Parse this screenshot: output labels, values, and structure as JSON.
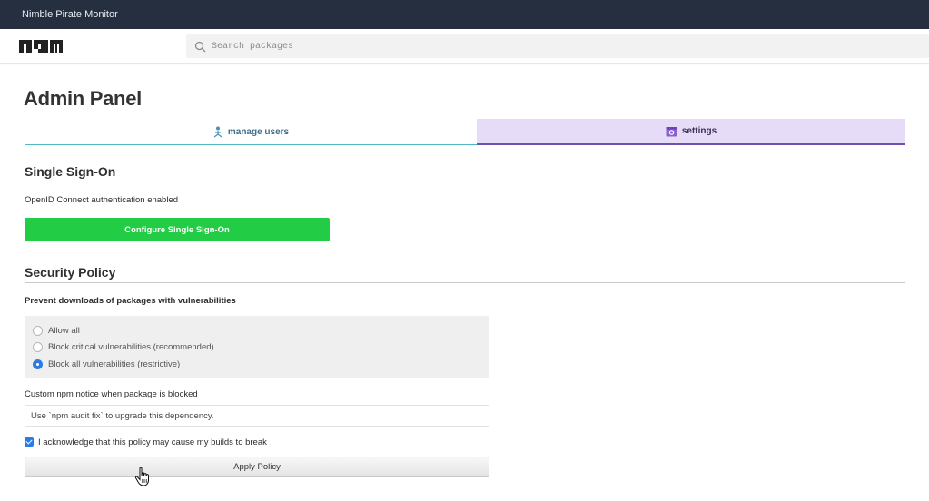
{
  "window": {
    "title": "Nimble Pirate Monitor"
  },
  "header": {
    "logo_text": "npm",
    "search": {
      "placeholder": "Search packages",
      "value": ""
    }
  },
  "page": {
    "title": "Admin Panel"
  },
  "tabs": [
    {
      "label": "manage users",
      "icon": "users-icon",
      "active": false
    },
    {
      "label": "settings",
      "icon": "settings-icon",
      "active": true
    }
  ],
  "sso": {
    "title": "Single Sign-On",
    "status_text": "OpenID Connect authentication enabled",
    "configure_button": "Configure Single Sign-On"
  },
  "security_policy": {
    "title": "Security Policy",
    "prevent_label": "Prevent downloads of packages with vulnerabilities",
    "options": [
      {
        "label": "Allow all",
        "selected": false
      },
      {
        "label": "Block critical vulnerabilities (recommended)",
        "selected": false
      },
      {
        "label": "Block all vulnerabilities (restrictive)",
        "selected": true
      }
    ],
    "notice_label": "Custom npm notice when package is blocked",
    "notice_value": "Use `npm audit fix` to upgrade this dependency.",
    "acknowledge_label": "I acknowledge that this policy may cause my builds to break",
    "acknowledged": true,
    "apply_button": "Apply Policy"
  },
  "colors": {
    "titlebar": "#252f3f",
    "sso_button": "#22cc44",
    "active_tab_bg": "#e6dcf8",
    "active_tab_border": "#6f4fb0",
    "inactive_tab_border": "#4fb8c6",
    "accent_blue": "#2c7be5"
  }
}
